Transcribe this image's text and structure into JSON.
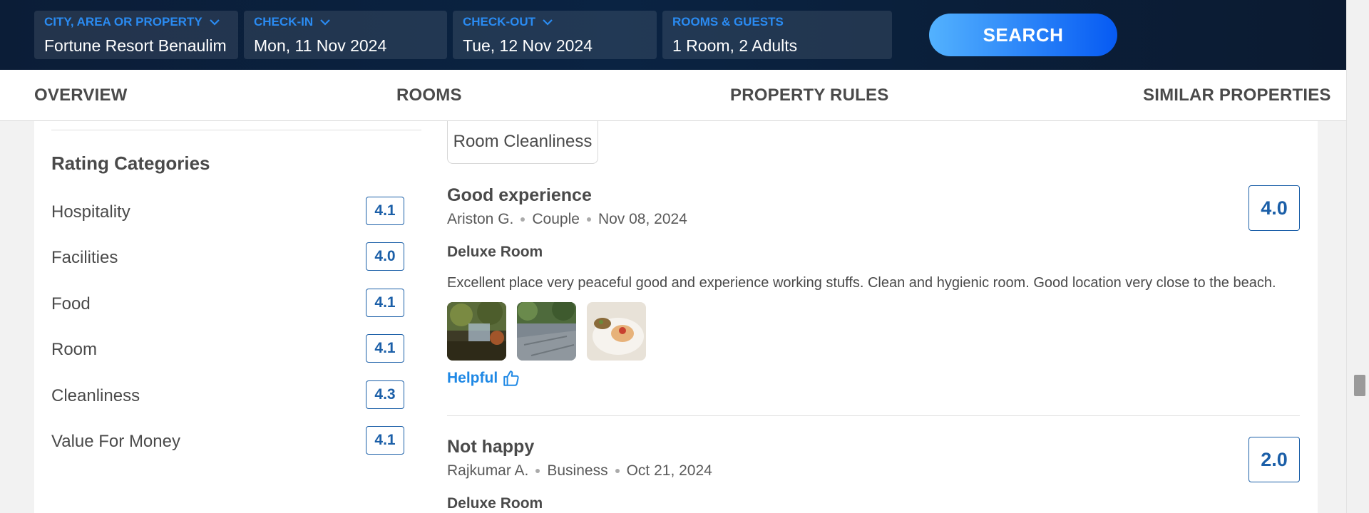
{
  "search": {
    "city_label": "CITY, AREA OR PROPERTY",
    "city_value": "Fortune Resort Benaulim",
    "checkin_label": "CHECK-IN",
    "checkin_value": "Mon, 11 Nov 2024",
    "checkout_label": "CHECK-OUT",
    "checkout_value": "Tue, 12 Nov 2024",
    "guests_label": "ROOMS & GUESTS",
    "guests_value": "1 Room, 2 Adults",
    "search_button": "SEARCH"
  },
  "tabs": [
    "OVERVIEW",
    "ROOMS",
    "PROPERTY RULES",
    "SIMILAR PROPERTIES"
  ],
  "ratings": {
    "title": "Rating Categories",
    "items": [
      {
        "name": "Hospitality",
        "score": "4.1"
      },
      {
        "name": "Facilities",
        "score": "4.0"
      },
      {
        "name": "Food",
        "score": "4.1"
      },
      {
        "name": "Room",
        "score": "4.1"
      },
      {
        "name": "Cleanliness",
        "score": "4.3"
      },
      {
        "name": "Value For Money",
        "score": "4.1"
      }
    ]
  },
  "filter_chip": "Room Cleanliness",
  "reviews": [
    {
      "title": "Good experience",
      "author": "Ariston G.",
      "type": "Couple",
      "date": "Nov 08, 2024",
      "score": "4.0",
      "room": "Deluxe Room",
      "text": "Excellent place very peaceful good and experience working stuffs. Clean and hygienic room. Good location very close to the beach.",
      "helpful": "Helpful"
    },
    {
      "title": "Not happy",
      "author": "Rajkumar A.",
      "type": "Business",
      "date": "Oct 21, 2024",
      "score": "2.0",
      "room": "Deluxe Room"
    }
  ],
  "colors": {
    "accent_blue": "#1b5fa8",
    "link_blue": "#1e88e5",
    "header_bg": "#0a2342"
  }
}
